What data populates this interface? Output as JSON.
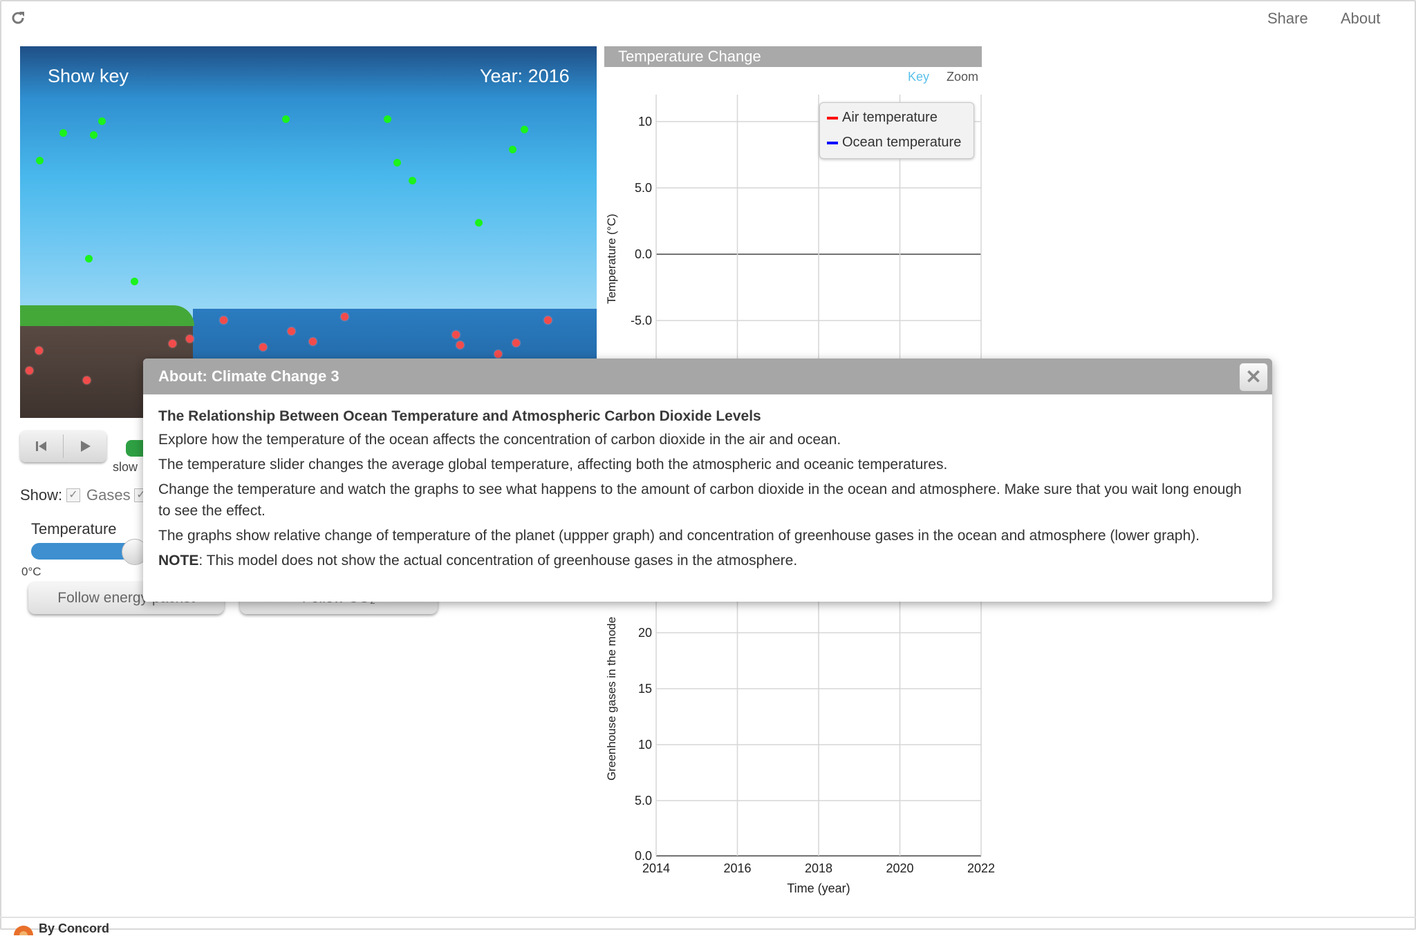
{
  "topbar": {
    "share_label": "Share",
    "about_label": "About"
  },
  "scene": {
    "show_key_label": "Show key",
    "year_label": "Year: 2016"
  },
  "controls": {
    "speed_slow_label": "slow",
    "show_label": "Show:",
    "gases_label": "Gases",
    "temperature_label": "Temperature",
    "temperature_min_label": "0°C",
    "follow_energy_label": "Follow energy packet",
    "follow_co2_label": "Follow CO₂"
  },
  "graph": {
    "title": "Temperature Change",
    "key_label": "Key",
    "zoom_label": "Zoom",
    "legend": [
      "Air temperature",
      "Ocean temperature"
    ],
    "colors": {
      "air": "#ff0000",
      "ocean": "#0000ff",
      "key_link": "#5bc0eb"
    }
  },
  "chart_data": [
    {
      "type": "line",
      "title": "Temperature Change",
      "ylabel": "Temperature (°C)",
      "x_range": [
        2014,
        2022
      ],
      "y_ticks": [
        "10",
        "5.0",
        "0.0",
        "-5.0"
      ],
      "x_ticks": [
        2014,
        2016,
        2018,
        2020,
        2022
      ],
      "grid": true,
      "legend_placement": "top-right",
      "series": [
        {
          "name": "Air temperature",
          "values": []
        },
        {
          "name": "Ocean temperature",
          "values": []
        }
      ]
    },
    {
      "type": "line",
      "ylabel": "Greenhouse gases in the mode",
      "xlabel": "Time (year)",
      "x_ticks": [
        2014,
        2016,
        2018,
        2020,
        2022
      ],
      "y_ticks": [
        "20",
        "15",
        "10",
        "5.0",
        "0.0"
      ],
      "grid": true,
      "series": []
    }
  ],
  "dialog": {
    "title": "About: Climate Change 3",
    "heading": "The Relationship Between Ocean Temperature and Atmospheric Carbon Dioxide Levels",
    "p1": "Explore how the temperature of the ocean affects the concentration of carbon dioxide in the air and ocean.",
    "p2": "The temperature slider changes the average global temperature, affecting both the atmospheric and oceanic temperatures.",
    "p3": "Change the temperature and watch the graphs to see what happens to the amount of carbon dioxide in the ocean and atmosphere. Make sure that you wait long enough to see the effect.",
    "p4": "The graphs show relative change of temperature of the planet (uppper graph) and concentration of greenhouse gases in the ocean and atmosphere (lower graph).",
    "note_label": "NOTE",
    "note_text": ": This model does not show the actual concentration of greenhouse gases in the atmosphere."
  },
  "footer": {
    "brand": "By Concord"
  }
}
